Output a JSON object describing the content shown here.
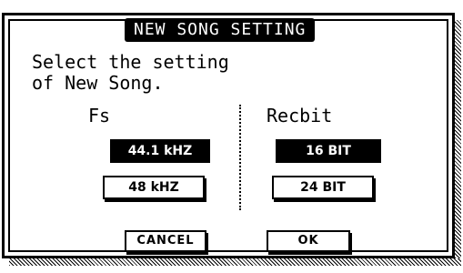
{
  "dialog": {
    "title": "NEW SONG SETTING",
    "message_line1": "Select the setting",
    "message_line2": "of New Song."
  },
  "fs": {
    "label": "Fs",
    "options": [
      "44.1 kHZ",
      "48 kHZ"
    ],
    "selected": "44.1 kHZ"
  },
  "recbit": {
    "label": "Recbit",
    "options": [
      "16 BIT",
      "24 BIT"
    ],
    "selected": "16 BIT"
  },
  "buttons": {
    "cancel": "CANCEL",
    "ok": "OK"
  },
  "colors": {
    "foreground": "#000000",
    "background": "#ffffff"
  }
}
